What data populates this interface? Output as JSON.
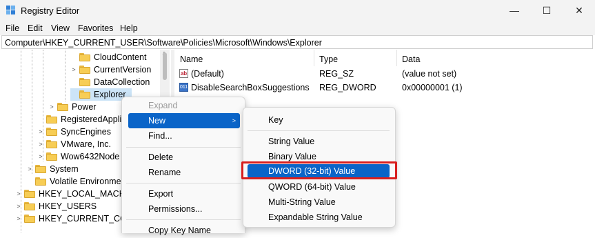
{
  "window": {
    "title": "Registry Editor",
    "min_glyph": "—",
    "max_glyph": "☐",
    "close_glyph": "✕"
  },
  "menubar": [
    "File",
    "Edit",
    "View",
    "Favorites",
    "Help"
  ],
  "address": "Computer\\HKEY_CURRENT_USER\\Software\\Policies\\Microsoft\\Windows\\Explorer",
  "tree": [
    {
      "label": "CloudContent",
      "chevron": ""
    },
    {
      "label": "CurrentVersion",
      "chevron": ">"
    },
    {
      "label": "DataCollection",
      "chevron": ""
    },
    {
      "label": "Explorer",
      "chevron": "",
      "selected": true
    },
    {
      "label": "Power",
      "chevron": ">"
    },
    {
      "label": "RegisteredApplic",
      "chevron": ""
    },
    {
      "label": "SyncEngines",
      "chevron": ">"
    },
    {
      "label": "VMware, Inc.",
      "chevron": ">"
    },
    {
      "label": "Wow6432Node",
      "chevron": ">"
    },
    {
      "label": "System",
      "chevron": ">"
    },
    {
      "label": "Volatile Environmen",
      "chevron": ""
    },
    {
      "label": "HKEY_LOCAL_MACHI",
      "chevron": ">"
    },
    {
      "label": "HKEY_USERS",
      "chevron": ">"
    },
    {
      "label": "HKEY_CURRENT_CON",
      "chevron": ">"
    }
  ],
  "list": {
    "headers": {
      "name": "Name",
      "type": "Type",
      "data": "Data"
    },
    "rows": [
      {
        "name": "(Default)",
        "type": "REG_SZ",
        "data": "(value not set)",
        "icon": "ab"
      },
      {
        "name": "DisableSearchBoxSuggestions",
        "type": "REG_DWORD",
        "data": "0x00000001 (1)",
        "icon": "011"
      }
    ]
  },
  "context_menu": {
    "items": [
      "Expand",
      "New",
      "Find...",
      "Delete",
      "Rename",
      "Export",
      "Permissions...",
      "Copy Key Name"
    ],
    "submenu_arrow": ">"
  },
  "new_submenu": {
    "items": [
      "Key",
      "String Value",
      "Binary Value",
      "DWORD (32-bit) Value",
      "QWORD (64-bit) Value",
      "Multi-String Value",
      "Expandable String Value"
    ]
  },
  "colors": {
    "highlight": "#0a64c8",
    "selection": "#cce4f7",
    "annotation": "#d81e1e"
  }
}
